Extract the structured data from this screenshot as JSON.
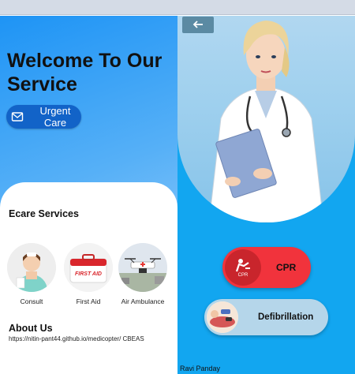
{
  "left": {
    "welcome_line1": "Welcome To Our",
    "welcome_line2": "Service",
    "urgent_label": "Urgent Care",
    "services_title": "Ecare Services",
    "services": [
      {
        "label": "Consult",
        "icon": "nurse-icon"
      },
      {
        "label": "First Aid",
        "icon": "first-aid-kit-icon"
      },
      {
        "label": "Air Ambulance",
        "icon": "drone-icon"
      }
    ],
    "about_title": "About Us",
    "about_url": "https://nitin-pant44.github.io/medicopter/ CBEAS"
  },
  "right": {
    "cpr_label": "CPR",
    "cpr_badge": "CPR",
    "defib_label": "Defibrillation",
    "footer": "Ravi Panday"
  },
  "colors": {
    "accent_blue": "#1263c8",
    "cpr_red": "#f1333c",
    "right_bg": "#12a6f0",
    "defib_bg": "#b5d6ea"
  }
}
